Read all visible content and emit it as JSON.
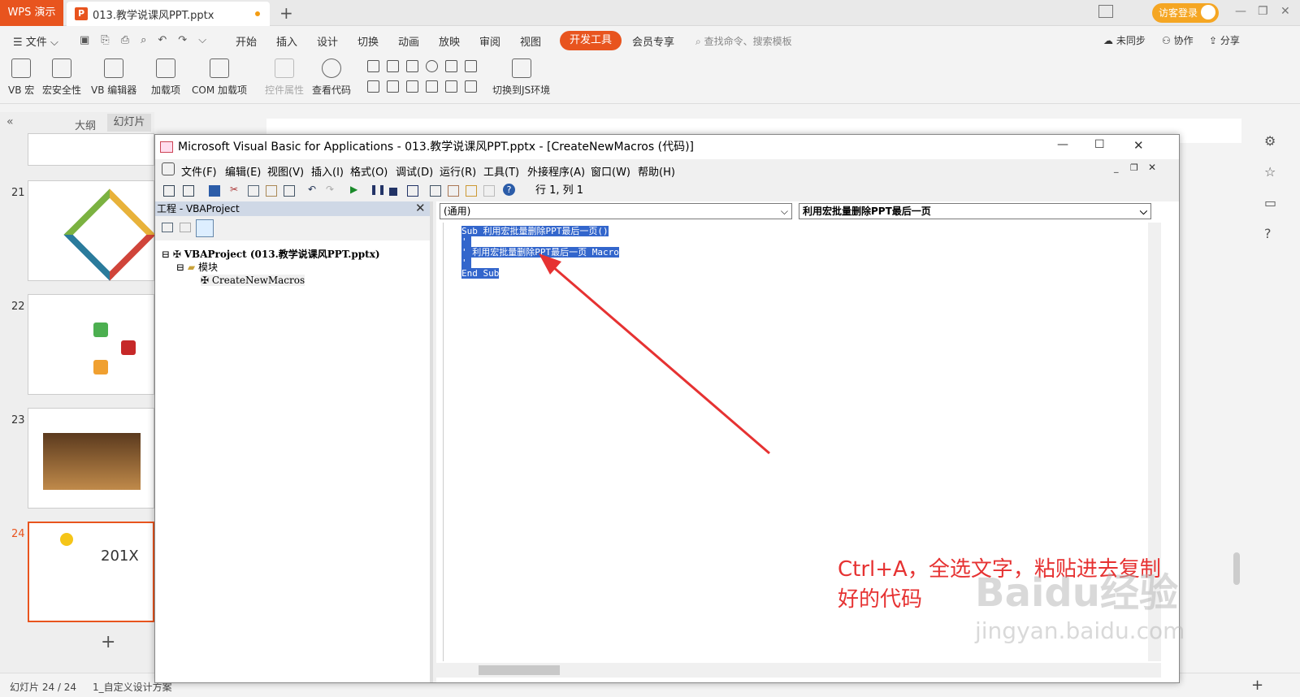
{
  "app": {
    "logo": "WPS 演示",
    "doc_tab": "013.教学说课风PPT.pptx",
    "login": "访客登录"
  },
  "menu": {
    "file": "文件",
    "items": [
      "开始",
      "插入",
      "设计",
      "切换",
      "动画",
      "放映",
      "审阅",
      "视图"
    ],
    "active": "开发工具",
    "member": "会员专享",
    "search_placeholder": "查找命令、搜索模板",
    "sync": "未同步",
    "collab": "协作",
    "share": "分享"
  },
  "ribbon": {
    "buttons": [
      "VB 宏",
      "宏安全性",
      "VB 编辑器",
      "加载项",
      "COM 加载项",
      "控件属性",
      "查看代码"
    ],
    "js": "切换到JS环境"
  },
  "left": {
    "tab_outline": "大纲",
    "tab_slides": "幻灯片",
    "slide_nums": [
      "21",
      "22",
      "23",
      "24"
    ],
    "add": "+"
  },
  "status": {
    "slide_count": "幻灯片 24 / 24",
    "theme": "1_自定义设计方案"
  },
  "vba": {
    "title": "Microsoft Visual Basic for Applications - 013.教学说课风PPT.pptx - [CreateNewMacros (代码)]",
    "menu": [
      "文件(F)",
      "编辑(E)",
      "视图(V)",
      "插入(I)",
      "格式(O)",
      "调试(D)",
      "运行(R)",
      "工具(T)",
      "外接程序(A)",
      "窗口(W)",
      "帮助(H)"
    ],
    "position": "行 1, 列 1",
    "project_header": "工程 - VBAProject",
    "tree": {
      "root": "VBAProject (013.教学说课风PPT.pptx)",
      "folder": "模块",
      "module": "CreateNewMacros"
    },
    "combo_left": "(通用)",
    "combo_right": "利用宏批量删除PPT最后一页",
    "code_lines": [
      "Sub 利用宏批量删除PPT最后一页()",
      "'",
      "' 利用宏批量删除PPT最后一页 Macro",
      "'",
      "End Sub"
    ]
  },
  "annotation": "Ctrl+A，全选文字，粘贴进去复制好的代码",
  "watermark": "Baidu经验",
  "watermark_url": "jingyan.baidu.com",
  "colors": {
    "accent": "#e8541e",
    "selection": "#3366cc",
    "arrow": "#e63232"
  }
}
